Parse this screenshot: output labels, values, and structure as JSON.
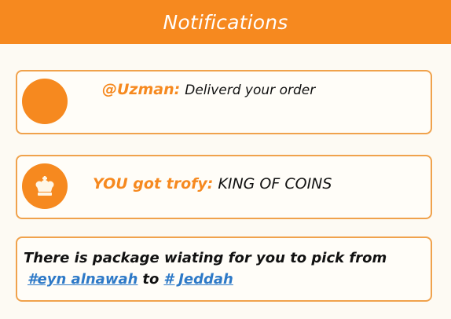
{
  "header": {
    "title": "Notifications"
  },
  "notifications": [
    {
      "user": "@Uzman:",
      "message": "Deliverd your order"
    },
    {
      "prefix": "YOU got trofy:",
      "achievement": "KING OF COINS",
      "icon": "crown-icon"
    },
    {
      "message": "There is package wiating for you to pick from",
      "from_tag": "#eyn alnawah",
      "connector": "to",
      "to_tag": "# Jeddah"
    }
  ],
  "colors": {
    "accent": "#f6891f",
    "link": "#2d79c7",
    "card_border": "#f0a24c",
    "background": "#fdfaf3"
  }
}
